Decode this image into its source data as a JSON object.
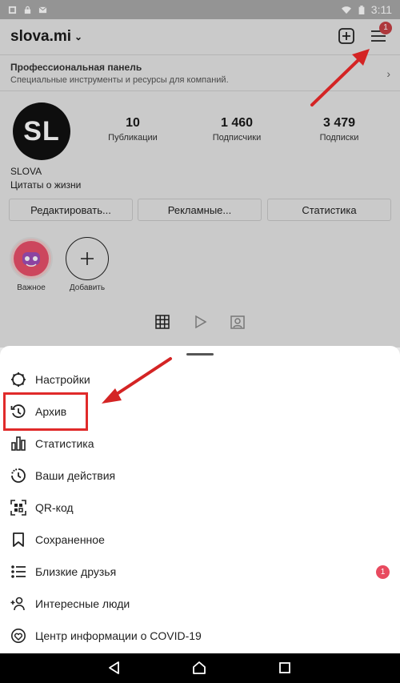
{
  "status_bar": {
    "time": "3:11"
  },
  "profile": {
    "username": "slova.mi",
    "header_badge": "1",
    "pro_panel": {
      "title": "Профессиональная панель",
      "subtitle": "Специальные инструменты и ресурсы для компаний."
    },
    "avatar_text": "SL",
    "stats": [
      {
        "value": "10",
        "label": "Публикации"
      },
      {
        "value": "1 460",
        "label": "Подписчики"
      },
      {
        "value": "3 479",
        "label": "Подписки"
      }
    ],
    "display_name": "SLOVA",
    "bio": "Цитаты о жизни",
    "buttons": {
      "edit": "Редактировать...",
      "ads": "Рекламные...",
      "stats": "Статистика"
    },
    "stories": [
      {
        "label": "Важное"
      },
      {
        "label": "Добавить"
      }
    ]
  },
  "menu": {
    "items": [
      {
        "label": "Настройки",
        "icon": "settings-icon"
      },
      {
        "label": "Архив",
        "icon": "archive-icon"
      },
      {
        "label": "Статистика",
        "icon": "insights-icon"
      },
      {
        "label": "Ваши действия",
        "icon": "activity-icon"
      },
      {
        "label": "QR-код",
        "icon": "qr-code-icon"
      },
      {
        "label": "Сохраненное",
        "icon": "saved-icon"
      },
      {
        "label": "Близкие друзья",
        "icon": "close-friends-icon",
        "badge": "1"
      },
      {
        "label": "Интересные люди",
        "icon": "discover-people-icon"
      },
      {
        "label": "Центр информации о COVID-19",
        "icon": "covid-info-icon"
      }
    ]
  },
  "colors": {
    "badge": "#e84a5f",
    "highlight": "#e02a2a",
    "arrow": "#d42424"
  }
}
